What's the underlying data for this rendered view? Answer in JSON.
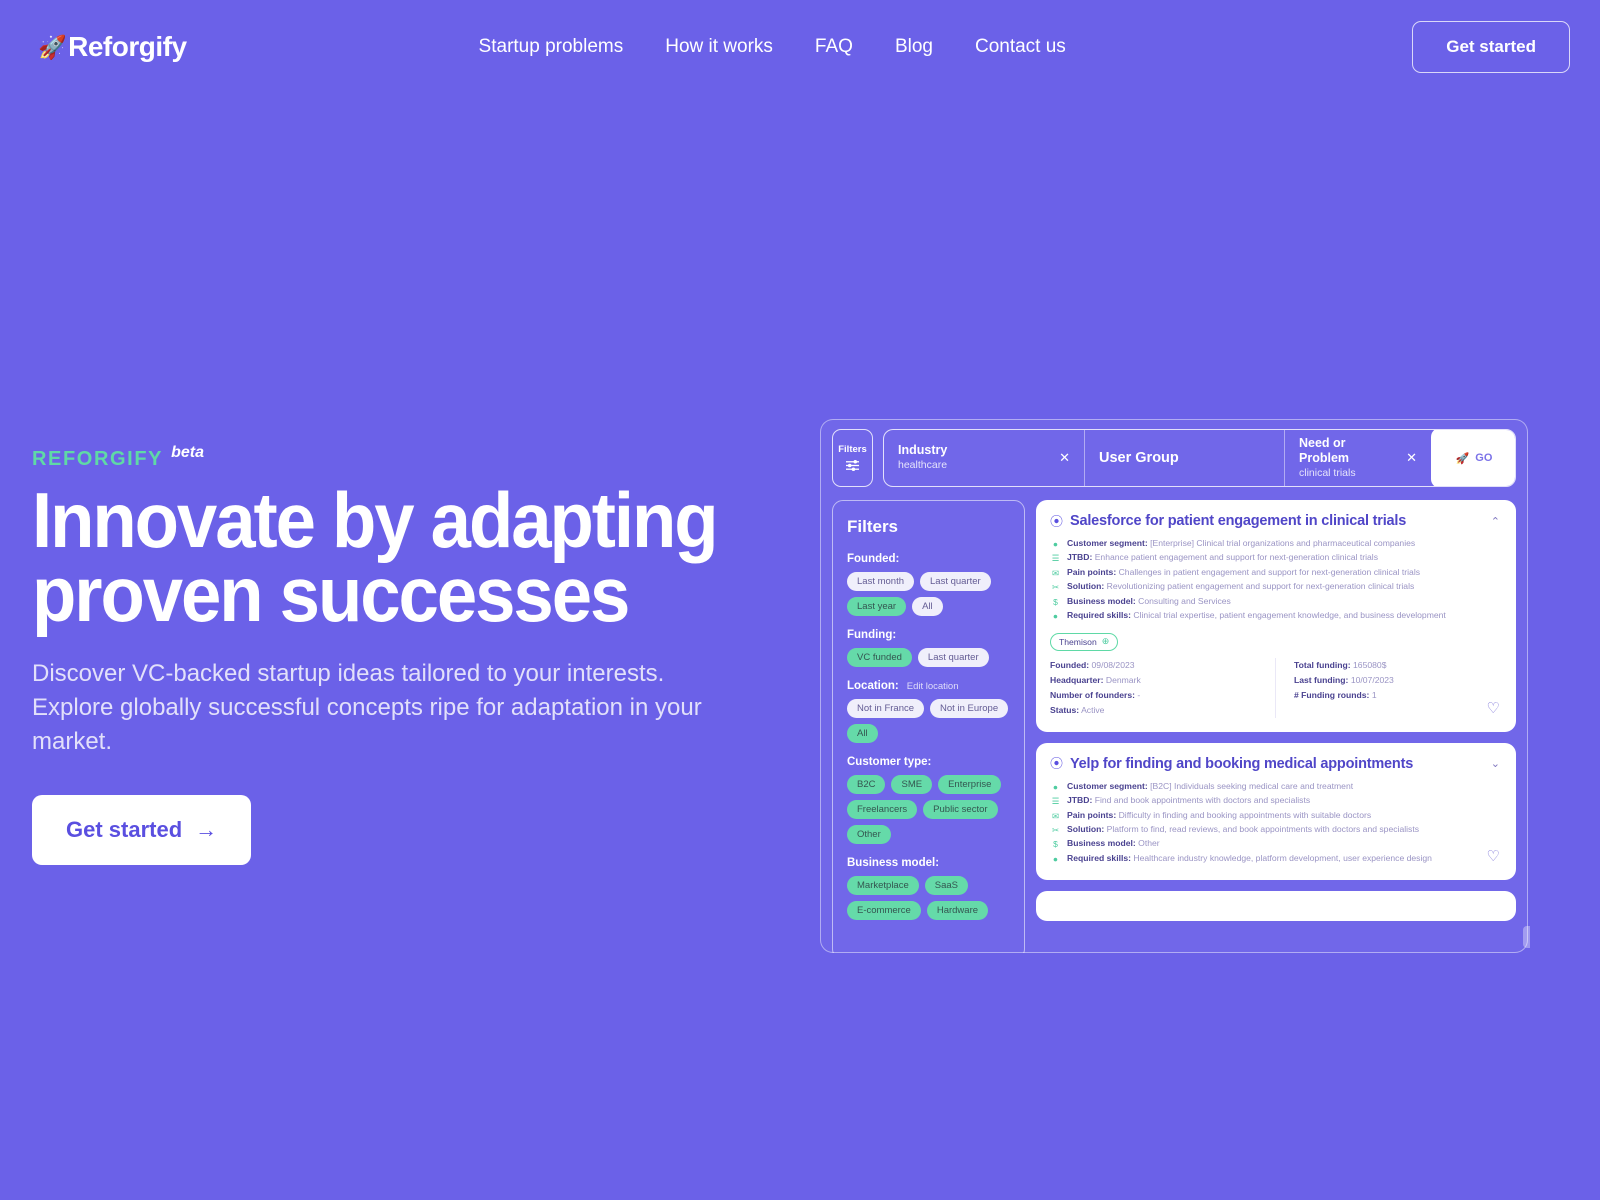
{
  "nav": {
    "logo_icon": "rocket-icon",
    "logo_text": "Reforgify",
    "links": [
      {
        "label": "Startup problems"
      },
      {
        "label": "How it works"
      },
      {
        "label": "FAQ"
      },
      {
        "label": "Blog"
      },
      {
        "label": "Contact us"
      }
    ],
    "cta_label": "Get started"
  },
  "hero": {
    "eyebrow": "REFORGIFY",
    "beta": "beta",
    "headline_line1": "Innovate by adapting",
    "headline_line2": "proven successes",
    "subhead": "Discover VC-backed startup ideas tailored to your interests. Explore globally successful concepts ripe for adaptation in your market.",
    "cta_label": "Get started",
    "cta_arrow": "→"
  },
  "mockup": {
    "search": {
      "filters_label": "Filters",
      "filters_icon": "sliders-icon",
      "fields": [
        {
          "label": "Industry",
          "value": "healthcare",
          "clear": "✕",
          "has_clear": true
        },
        {
          "placeholder": "User Group",
          "has_clear": false
        },
        {
          "label": "Need or Problem",
          "value": "clinical trials",
          "clear": "✕",
          "has_clear": true
        }
      ],
      "go_label": "GO",
      "go_icon": "rocket-icon"
    },
    "filters_panel": {
      "title": "Filters",
      "groups": [
        {
          "title": "Founded:",
          "action": "",
          "chips": [
            {
              "label": "Last month",
              "active": false
            },
            {
              "label": "Last quarter",
              "active": false
            },
            {
              "label": "Last year",
              "active": true
            },
            {
              "label": "All",
              "active": false
            }
          ]
        },
        {
          "title": "Funding:",
          "action": "",
          "chips": [
            {
              "label": "VC funded",
              "active": true
            },
            {
              "label": "Last quarter",
              "active": false
            }
          ]
        },
        {
          "title": "Location:",
          "action": "Edit location",
          "chips": [
            {
              "label": "Not in France",
              "active": false
            },
            {
              "label": "Not in Europe",
              "active": false
            },
            {
              "label": "All",
              "active": true
            }
          ]
        },
        {
          "title": "Customer type:",
          "action": "",
          "chips": [
            {
              "label": "B2C",
              "active": true
            },
            {
              "label": "SME",
              "active": true
            },
            {
              "label": "Enterprise",
              "active": true
            },
            {
              "label": "Freelancers",
              "active": true
            },
            {
              "label": "Public sector",
              "active": true
            },
            {
              "label": "Other",
              "active": true
            }
          ]
        },
        {
          "title": "Business model:",
          "action": "",
          "chips": [
            {
              "label": "Marketplace",
              "active": true
            },
            {
              "label": "SaaS",
              "active": true
            },
            {
              "label": "E-commerce",
              "active": true
            },
            {
              "label": "Hardware",
              "active": true
            }
          ]
        }
      ]
    },
    "cards": [
      {
        "title": "Salesforce for patient engagement in clinical trials",
        "chevron": "⌃",
        "favorite_icon": "heart-outline-icon",
        "rows": [
          {
            "icon": "person-icon",
            "glyph": "●",
            "label": "Customer segment:",
            "value": "[Enterprise] Clinical trial organizations and pharmaceutical companies"
          },
          {
            "icon": "list-icon",
            "glyph": "☰",
            "label": "JTBD:",
            "value": "Enhance patient engagement and support for next-generation clinical trials"
          },
          {
            "icon": "envelope-icon",
            "glyph": "✉",
            "label": "Pain points:",
            "value": "Challenges in patient engagement and support for next-generation clinical trials"
          },
          {
            "icon": "scissors-icon",
            "glyph": "✂",
            "label": "Solution:",
            "value": "Revolutionizing patient engagement and support for next-generation clinical trials"
          },
          {
            "icon": "dollar-icon",
            "glyph": "$",
            "label": "Business model:",
            "value": "Consulting and Services"
          },
          {
            "icon": "circle-icon",
            "glyph": "●",
            "label": "Required skills:",
            "value": "Clinical trial expertise, patient engagement knowledge, and business development"
          }
        ],
        "tag": {
          "label": "Themison",
          "icon": "globe-icon",
          "glyph": "⊕"
        },
        "meta_left": [
          {
            "label": "Founded:",
            "value": "09/08/2023"
          },
          {
            "label": "Headquarter:",
            "value": "Denmark"
          },
          {
            "label": "Number of founders:",
            "value": "-"
          },
          {
            "label": "Status:",
            "value": "Active"
          }
        ],
        "meta_right": [
          {
            "label": "Total funding:",
            "value": "165080$"
          },
          {
            "label": "Last funding:",
            "value": "10/07/2023"
          },
          {
            "label": "# Funding rounds:",
            "value": "1"
          }
        ]
      },
      {
        "title": "Yelp for finding and booking medical appointments",
        "chevron": "⌄",
        "favorite_icon": "heart-outline-icon",
        "rows": [
          {
            "icon": "person-icon",
            "glyph": "●",
            "label": "Customer segment:",
            "value": "[B2C] Individuals seeking medical care and treatment"
          },
          {
            "icon": "list-icon",
            "glyph": "☰",
            "label": "JTBD:",
            "value": "Find and book appointments with doctors and specialists"
          },
          {
            "icon": "envelope-icon",
            "glyph": "✉",
            "label": "Pain points:",
            "value": "Difficulty in finding and booking appointments with suitable doctors"
          },
          {
            "icon": "scissors-icon",
            "glyph": "✂",
            "label": "Solution:",
            "value": "Platform to find, read reviews, and book appointments with doctors and specialists"
          },
          {
            "icon": "dollar-icon",
            "glyph": "$",
            "label": "Business model:",
            "value": "Other"
          },
          {
            "icon": "circle-icon",
            "glyph": "●",
            "label": "Required skills:",
            "value": "Healthcare industry knowledge, platform development, user experience design"
          }
        ],
        "meta_left": [],
        "meta_right": []
      }
    ]
  },
  "colors": {
    "background": "#6B61E8",
    "accent_green": "#5FD9A6",
    "card_purple": "#5046C8",
    "white": "#FFFFFF"
  }
}
